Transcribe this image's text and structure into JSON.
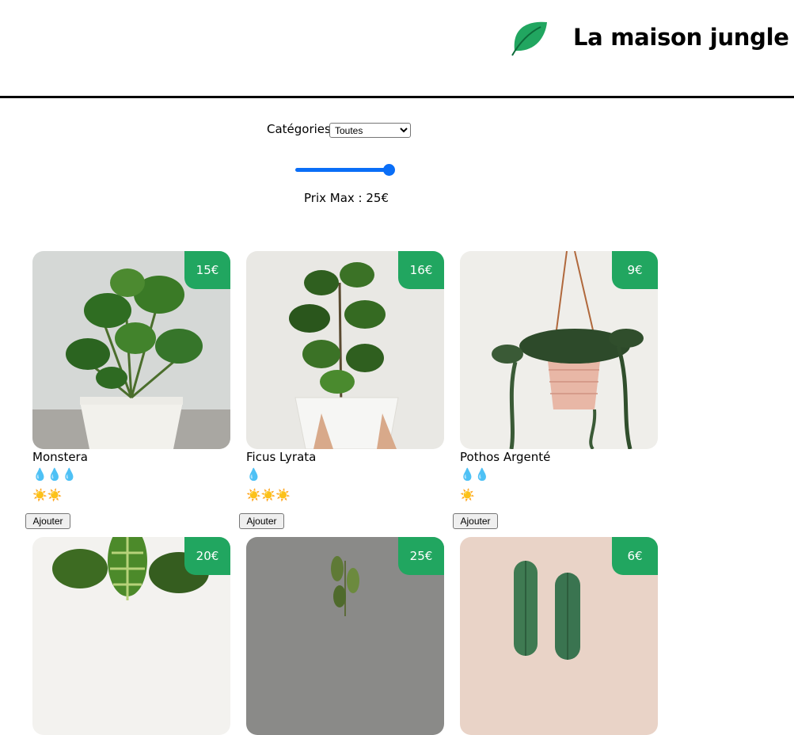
{
  "header": {
    "title": "La maison jungle"
  },
  "filters": {
    "category_label": "Catégories",
    "category_selected": "Toutes",
    "price_label": "Prix Max : 25€",
    "price_max": 25,
    "price_limit": 25
  },
  "add_label": "Ajouter",
  "plants": [
    {
      "name": "Monstera",
      "price": "15€",
      "water_icons": "💧💧💧",
      "light_icons": "☀️☀️"
    },
    {
      "name": "Ficus Lyrata",
      "price": "16€",
      "water_icons": "💧",
      "light_icons": "☀️☀️☀️"
    },
    {
      "name": "Pothos Argenté",
      "price": "9€",
      "water_icons": "💧💧",
      "light_icons": "☀️"
    },
    {
      "price": "20€"
    },
    {
      "price": "25€"
    },
    {
      "price": "6€"
    }
  ],
  "colors": {
    "accent_green": "#21a660",
    "slider_blue": "#0a6ef7"
  }
}
